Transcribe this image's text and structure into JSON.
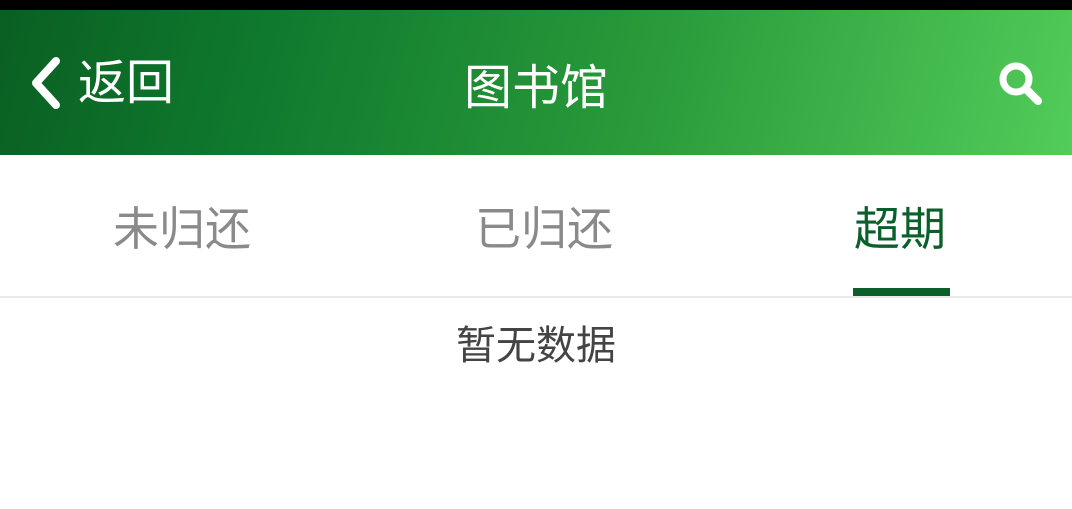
{
  "nav": {
    "back_label": "返回",
    "title": "图书馆"
  },
  "tabs": [
    {
      "label": "未归还",
      "active": false
    },
    {
      "label": "已归还",
      "active": false
    },
    {
      "label": "超期",
      "active": true
    }
  ],
  "content": {
    "empty_text": "暂无数据"
  },
  "colors": {
    "accent": "#0b5f2a",
    "header_gradient_start": "#0a5f22",
    "header_gradient_end": "#52cc5a",
    "tab_inactive": "#8a8a8a"
  },
  "icons": {
    "back": "chevron-left-icon",
    "search": "search-icon"
  }
}
